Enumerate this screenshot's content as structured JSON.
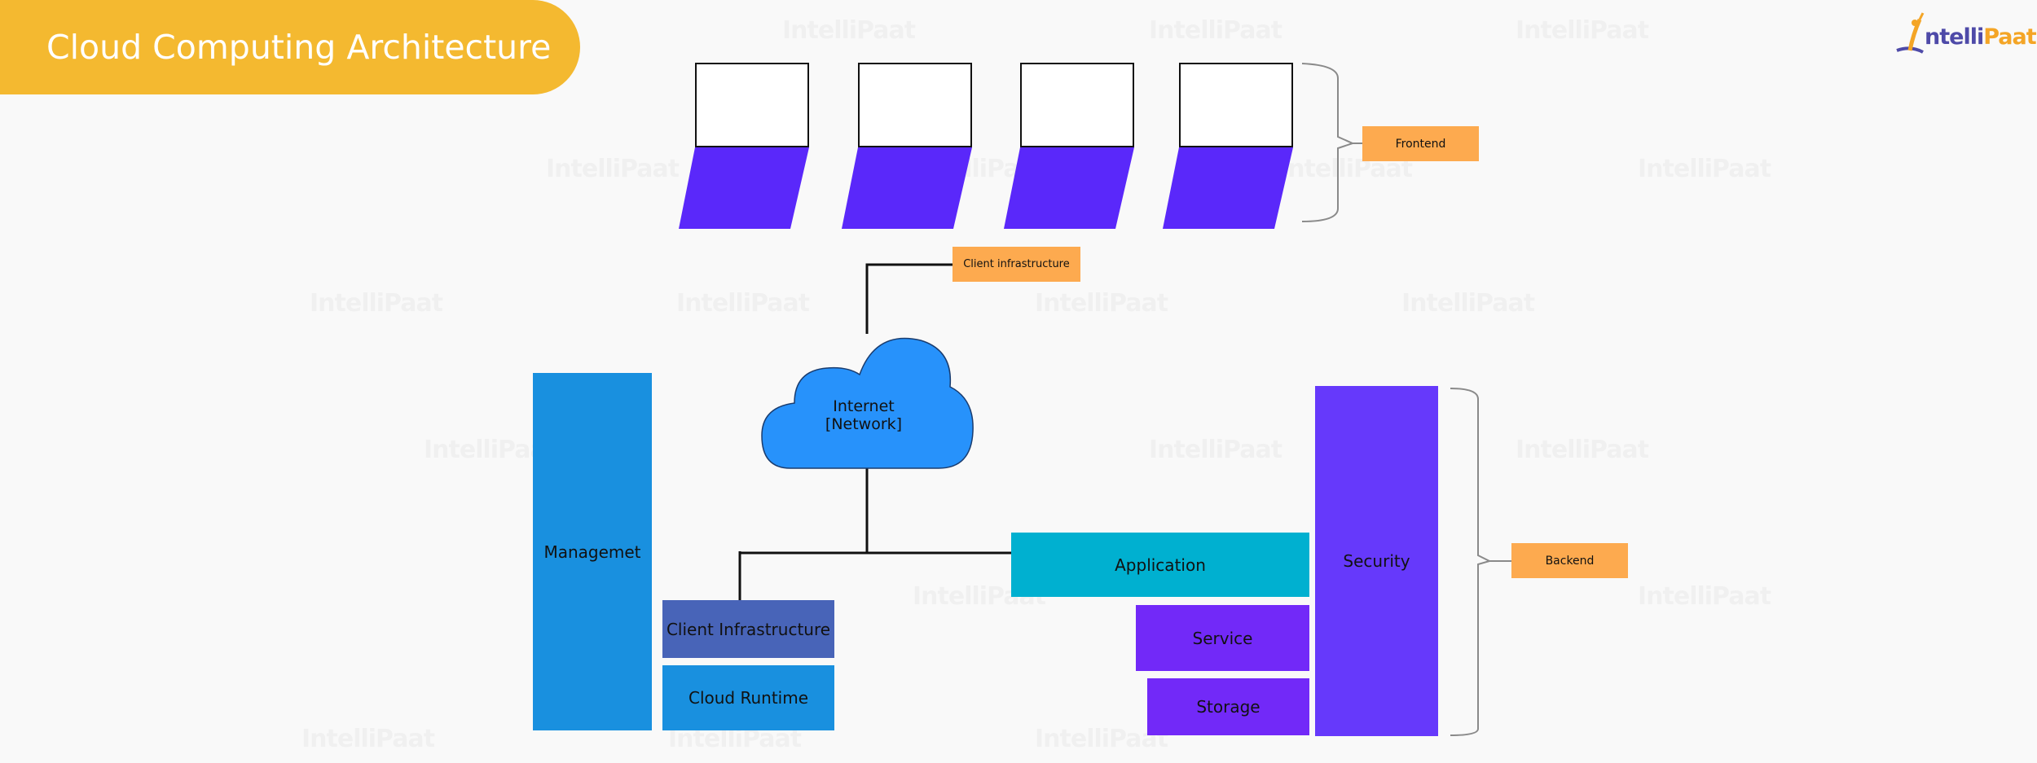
{
  "title": "Cloud Computing Architecture",
  "logo": {
    "part1": "ntelli",
    "part2": "Paat",
    "initial": "I"
  },
  "watermark_text": "IntelliPaat",
  "frontend": {
    "laptop_count": 4,
    "label": "Frontend"
  },
  "network": {
    "callout": "Client infrastructure",
    "cloud_line1": "Internet",
    "cloud_line2": "[Network]"
  },
  "backend": {
    "label": "Backend",
    "blocks": {
      "management": "Managemet",
      "client_infrastructure": "Client Infrastructure",
      "cloud_runtime": "Cloud Runtime",
      "application": "Application",
      "service": "Service",
      "storage": "Storage",
      "security": "Security"
    }
  },
  "colors": {
    "banner": "#f4b930",
    "tag": "#fdaa4f",
    "laptop_base": "#5a28fa",
    "cloud": "#2792fb",
    "management": "#1990df",
    "client_infra": "#4864b8",
    "cloud_runtime": "#1990df",
    "application": "#00b0d0",
    "service_storage": "#7229f8",
    "security": "#6639fb"
  }
}
